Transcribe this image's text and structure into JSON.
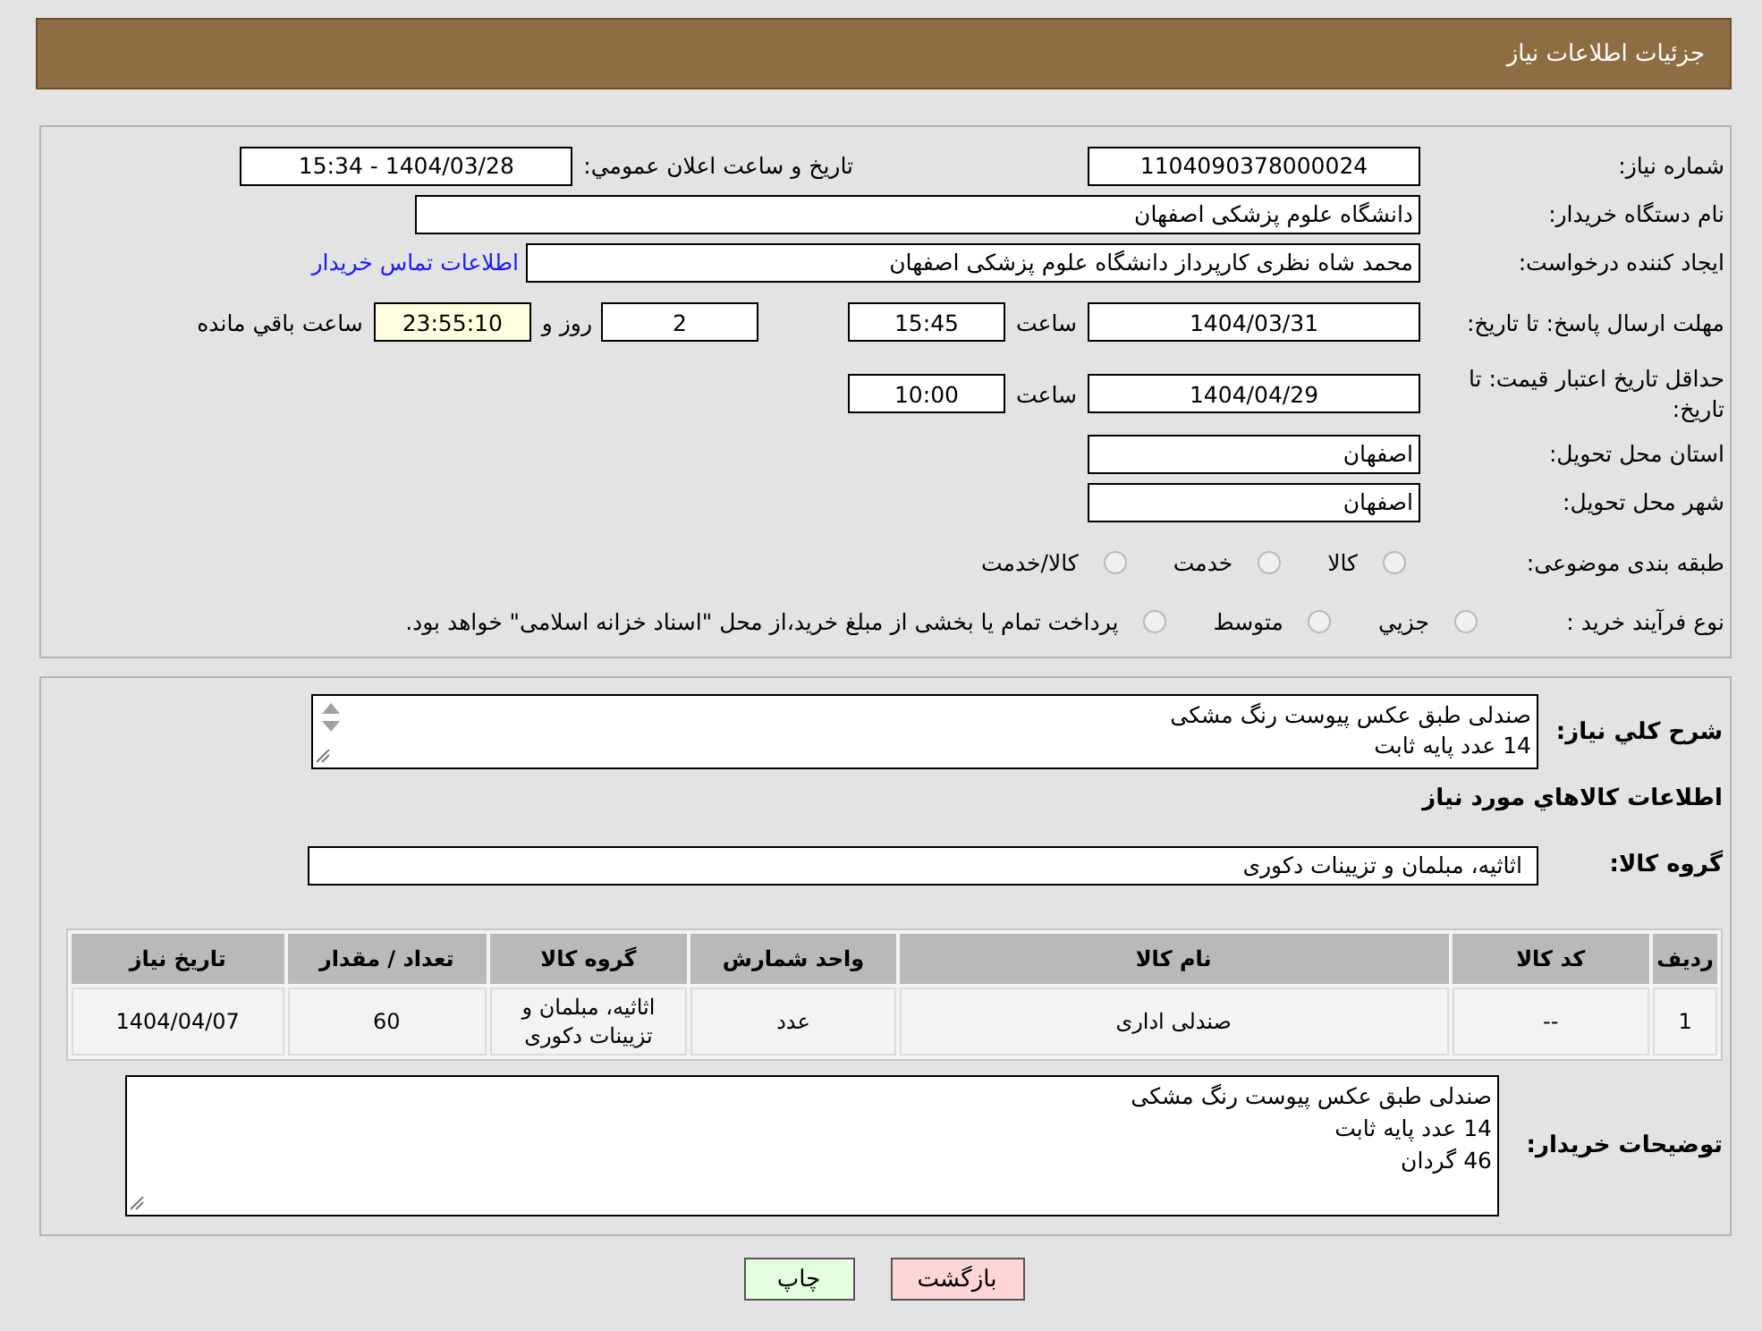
{
  "header": {
    "title": "جزئیات اطلاعات نیاز"
  },
  "details": {
    "need_number": {
      "label": "شماره نیاز:",
      "value": "1104090378000024"
    },
    "announce": {
      "label": "تاریخ و ساعت اعلان عمومي:",
      "value": "1404/03/28 - 15:34"
    },
    "buyer_org": {
      "label": "نام دستگاه خریدار:",
      "value": "دانشگاه علوم پزشکی اصفهان"
    },
    "requester": {
      "label": "ایجاد کننده درخواست:",
      "value": "محمد شاه نظری کارپرداز دانشگاه علوم پزشکی اصفهان",
      "link": "اطلاعات تماس خریدار"
    },
    "reply_deadline": {
      "label": "مهلت ارسال پاسخ: تا تاریخ:",
      "date": "1404/03/31",
      "time_label": "ساعت",
      "time": "15:45",
      "days": "2",
      "days_label": "روز و",
      "remaining": "23:55:10",
      "remaining_label": "ساعت باقي مانده"
    },
    "validity": {
      "label": "حداقل تاریخ اعتبار قیمت: تا تاریخ:",
      "date": "1404/04/29",
      "time_label": "ساعت",
      "time": "10:00"
    },
    "province": {
      "label": "استان محل تحویل:",
      "value": "اصفهان"
    },
    "city": {
      "label": "شهر محل تحویل:",
      "value": "اصفهان"
    },
    "category": {
      "label": "طبقه بندی موضوعی:",
      "options": [
        {
          "label": "کالا",
          "selected": false
        },
        {
          "label": "خدمت",
          "selected": false
        },
        {
          "label": "کالا/خدمت",
          "selected": false
        }
      ]
    },
    "process": {
      "label": "نوع فرآیند خرید :",
      "options": [
        {
          "label": "جزيي",
          "selected": false
        },
        {
          "label": "متوسط",
          "selected": false
        },
        {
          "label": "پرداخت تمام یا بخشی از مبلغ خرید،از محل \"اسناد خزانه اسلامی\" خواهد بود.",
          "selected": false
        }
      ]
    }
  },
  "goods": {
    "summary": {
      "label": "شرح کلي نیاز:",
      "lines": [
        "صندلی طبق عکس پیوست رنگ مشکی",
        "14 عدد پایه ثابت"
      ]
    },
    "heading": "اطلاعات کالاهاي مورد نیاز",
    "group": {
      "label": "گروه کالا:",
      "value": "اثاثیه، مبلمان و تزیینات دکوری"
    },
    "table": {
      "columns": [
        "ردیف",
        "کد کالا",
        "نام کالا",
        "واحد شمارش",
        "گروه کالا",
        "تعداد / مقدار",
        "تاریخ نیاز"
      ],
      "rows": [
        [
          "1",
          "--",
          "صندلی اداری",
          "عدد",
          "اثاثیه، مبلمان و تزیینات دکوری",
          "60",
          "1404/04/07"
        ]
      ]
    },
    "buyer_notes": {
      "label": "توضیحات خریدار:",
      "lines": [
        "صندلی طبق عکس پیوست رنگ مشکی",
        "14 عدد پایه ثابت",
        "46 گردان"
      ]
    }
  },
  "buttons": [
    {
      "label": "بازگشت",
      "kind": "back"
    },
    {
      "label": "چاپ",
      "kind": "print"
    }
  ]
}
